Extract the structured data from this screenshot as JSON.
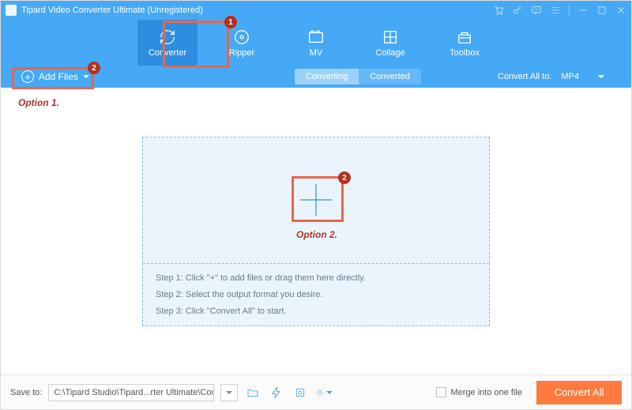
{
  "titlebar": {
    "title": "Tipard Video Converter Ultimate (Unregistered)"
  },
  "navtabs": {
    "converter": "Converter",
    "ripper": "Ripper",
    "mv": "MV",
    "collage": "Collage",
    "toolbox": "Toolbox"
  },
  "subbar": {
    "add_files": "Add Files",
    "converting": "Converting",
    "converted": "Converted",
    "convert_all_to_label": "Convert All to:",
    "format": "MP4"
  },
  "dropzone": {
    "step1": "Step 1: Click \"+\" to add files or drag them here directly.",
    "step2": "Step 2: Select the output format you desire.",
    "step3": "Step 3: Click \"Convert All\" to start."
  },
  "footer": {
    "save_to_label": "Save to:",
    "save_to_path": "C:\\Tipard Studio\\Tipard...rter Ultimate\\Converted",
    "merge_label": "Merge into one file",
    "convert_all": "Convert All"
  },
  "annotations": {
    "badge1": "1",
    "badge2_a": "2",
    "badge2_b": "2",
    "option1": "Option 1.",
    "option2": "Option 2."
  }
}
